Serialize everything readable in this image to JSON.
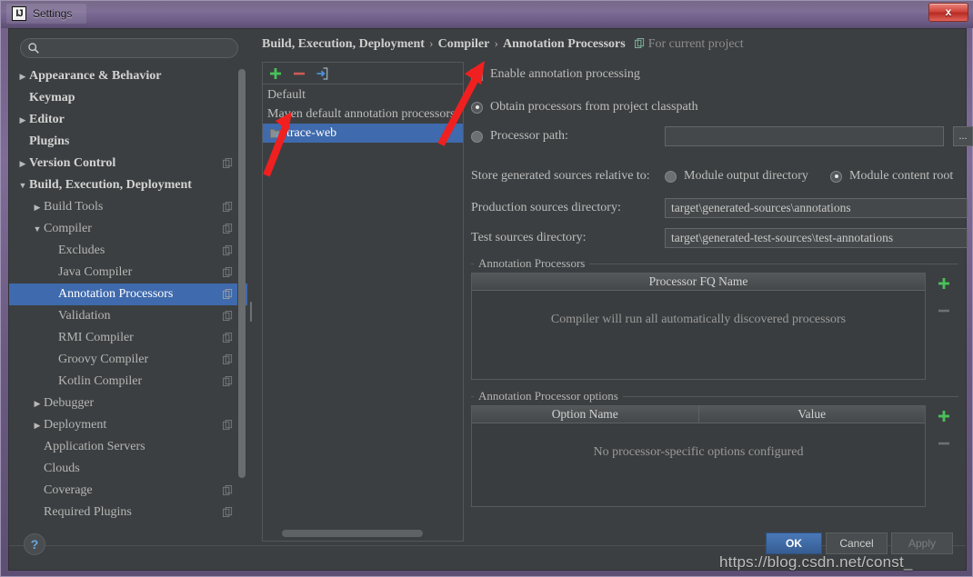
{
  "window": {
    "title": "Settings",
    "app_icon": "intellij-idea-icon",
    "close_label": "x",
    "titlebar_color": "#7c6b95",
    "close_color": "#d1453c"
  },
  "search": {
    "value": "",
    "placeholder": "",
    "icon": "search-icon"
  },
  "sidebar": {
    "items": [
      {
        "label": "Appearance & Behavior",
        "twisty": "collapsed",
        "indent": 0,
        "bold": true,
        "copy_icon": false,
        "selected": false
      },
      {
        "label": "Keymap",
        "twisty": "none",
        "indent": 0,
        "bold": true,
        "copy_icon": false,
        "selected": false
      },
      {
        "label": "Editor",
        "twisty": "collapsed",
        "indent": 0,
        "bold": true,
        "copy_icon": false,
        "selected": false
      },
      {
        "label": "Plugins",
        "twisty": "none",
        "indent": 0,
        "bold": true,
        "copy_icon": false,
        "selected": false
      },
      {
        "label": "Version Control",
        "twisty": "collapsed",
        "indent": 0,
        "bold": true,
        "copy_icon": true,
        "selected": false
      },
      {
        "label": "Build, Execution, Deployment",
        "twisty": "expanded",
        "indent": 0,
        "bold": true,
        "copy_icon": false,
        "selected": false
      },
      {
        "label": "Build Tools",
        "twisty": "collapsed",
        "indent": 1,
        "bold": false,
        "copy_icon": true,
        "selected": false
      },
      {
        "label": "Compiler",
        "twisty": "expanded",
        "indent": 1,
        "bold": false,
        "copy_icon": true,
        "selected": false
      },
      {
        "label": "Excludes",
        "twisty": "none",
        "indent": 2,
        "bold": false,
        "copy_icon": true,
        "selected": false
      },
      {
        "label": "Java Compiler",
        "twisty": "none",
        "indent": 2,
        "bold": false,
        "copy_icon": true,
        "selected": false
      },
      {
        "label": "Annotation Processors",
        "twisty": "none",
        "indent": 2,
        "bold": false,
        "copy_icon": true,
        "selected": true
      },
      {
        "label": "Validation",
        "twisty": "none",
        "indent": 2,
        "bold": false,
        "copy_icon": true,
        "selected": false
      },
      {
        "label": "RMI Compiler",
        "twisty": "none",
        "indent": 2,
        "bold": false,
        "copy_icon": true,
        "selected": false
      },
      {
        "label": "Groovy Compiler",
        "twisty": "none",
        "indent": 2,
        "bold": false,
        "copy_icon": true,
        "selected": false
      },
      {
        "label": "Kotlin Compiler",
        "twisty": "none",
        "indent": 2,
        "bold": false,
        "copy_icon": true,
        "selected": false
      },
      {
        "label": "Debugger",
        "twisty": "collapsed",
        "indent": 1,
        "bold": false,
        "copy_icon": false,
        "selected": false
      },
      {
        "label": "Deployment",
        "twisty": "collapsed",
        "indent": 1,
        "bold": false,
        "copy_icon": true,
        "selected": false
      },
      {
        "label": "Application Servers",
        "twisty": "none",
        "indent": 1,
        "bold": false,
        "copy_icon": false,
        "selected": false
      },
      {
        "label": "Clouds",
        "twisty": "none",
        "indent": 1,
        "bold": false,
        "copy_icon": false,
        "selected": false
      },
      {
        "label": "Coverage",
        "twisty": "none",
        "indent": 1,
        "bold": false,
        "copy_icon": true,
        "selected": false
      },
      {
        "label": "Required Plugins",
        "twisty": "none",
        "indent": 1,
        "bold": false,
        "copy_icon": true,
        "selected": false
      }
    ]
  },
  "breadcrumb": {
    "parts": [
      "Build, Execution, Deployment",
      "Compiler",
      "Annotation Processors"
    ],
    "separator": "›",
    "scope_label": "For current project",
    "scope_icon": "project-scope-icon"
  },
  "profiles": {
    "toolbar": [
      {
        "name": "add-profile-button",
        "icon": "plus-icon",
        "color": "#49c15a"
      },
      {
        "name": "remove-profile-button",
        "icon": "minus-icon",
        "color": "#cf5b56"
      },
      {
        "name": "move-to-profile-button",
        "icon": "import-icon",
        "color": "#4a90d9"
      }
    ],
    "items": [
      {
        "label": "Default",
        "child": false,
        "selected": false,
        "folder_icon": false
      },
      {
        "label": "Maven default annotation processors",
        "child": false,
        "selected": false,
        "folder_icon": false
      },
      {
        "label": "trace-web",
        "child": true,
        "selected": true,
        "folder_icon": true
      }
    ]
  },
  "settings": {
    "enable_annotation_processing": {
      "label": "Enable annotation processing",
      "checked": true
    },
    "source_mode": {
      "options": [
        {
          "label": "Obtain processors from project classpath",
          "selected": true
        },
        {
          "label": "Processor path:",
          "selected": false
        }
      ],
      "processor_path_value": "",
      "browse_label": "..."
    },
    "store_relative_to": {
      "label": "Store generated sources relative to:",
      "options": [
        {
          "label": "Module output directory",
          "selected": false
        },
        {
          "label": "Module content root",
          "selected": true
        }
      ]
    },
    "production_sources": {
      "label": "Production sources directory:",
      "value": "target\\generated-sources\\annotations"
    },
    "test_sources": {
      "label": "Test sources directory:",
      "value": "target\\generated-test-sources\\test-annotations"
    },
    "processors_group": {
      "title": "Annotation Processors",
      "columns": [
        "Processor FQ Name"
      ],
      "rows": [],
      "empty_message": "Compiler will run all automatically discovered processors",
      "add_icon": "plus-icon",
      "remove_icon": "minus-icon"
    },
    "options_group": {
      "title": "Annotation Processor options",
      "columns": [
        "Option Name",
        "Value"
      ],
      "rows": [],
      "empty_message": "No processor-specific options configured",
      "add_icon": "plus-icon",
      "remove_icon": "minus-icon"
    }
  },
  "footer": {
    "help_label": "?",
    "buttons": [
      {
        "label": "OK",
        "state": "default"
      },
      {
        "label": "Cancel",
        "state": "normal"
      },
      {
        "label": "Apply",
        "state": "disabled"
      }
    ]
  },
  "watermark": {
    "text": "https://blog.csdn.net/const_"
  },
  "annotations": {
    "arrow_color": "#f02020",
    "arrows": [
      {
        "name": "arrow-to-enable-checkbox",
        "points_to": "enable-annotation-processing-checkbox"
      },
      {
        "name": "arrow-to-trace-web-profile",
        "points_to": "profile-item-trace-web"
      }
    ]
  }
}
